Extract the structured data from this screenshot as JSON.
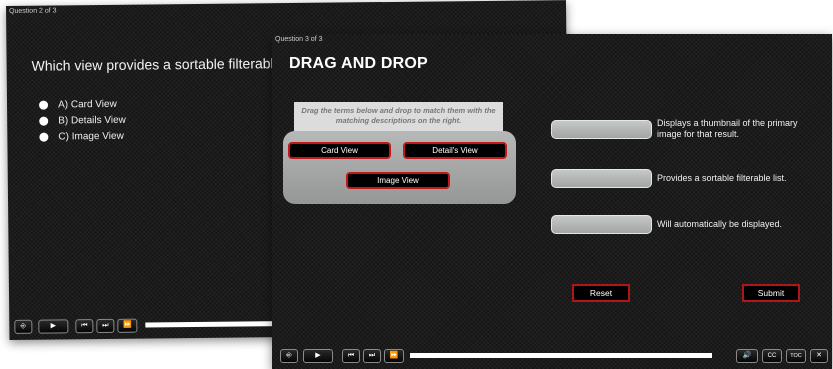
{
  "back_slide": {
    "counter": "Question 2 of 3",
    "question": "Which view provides a sortable filterable list?",
    "options": [
      "A) Card View",
      "B) Details View",
      "C) Image View"
    ]
  },
  "front_slide": {
    "counter": "Question 3 of 3",
    "title": "DRAG AND DROP",
    "instructions": "Drag the terms below and drop to match them with the matching descriptions on the right.",
    "terms": [
      "Card View",
      "Detail's View",
      "Image View"
    ],
    "descriptions": [
      "Displays a thumbnail of the primary image for that result.",
      "Provides a sortable filterable list.",
      "Will automatically be displayed."
    ],
    "reset_label": "Reset",
    "submit_label": "Submit"
  },
  "player": {
    "exit_icon": "⎆",
    "play_icon": "▶",
    "prev_icon": "⏮",
    "next_icon": "⏭",
    "ff_icon": "⏩",
    "volume_icon": "🔊",
    "cc_label": "CC",
    "toc_label": "TOC",
    "close_icon": "✕"
  }
}
